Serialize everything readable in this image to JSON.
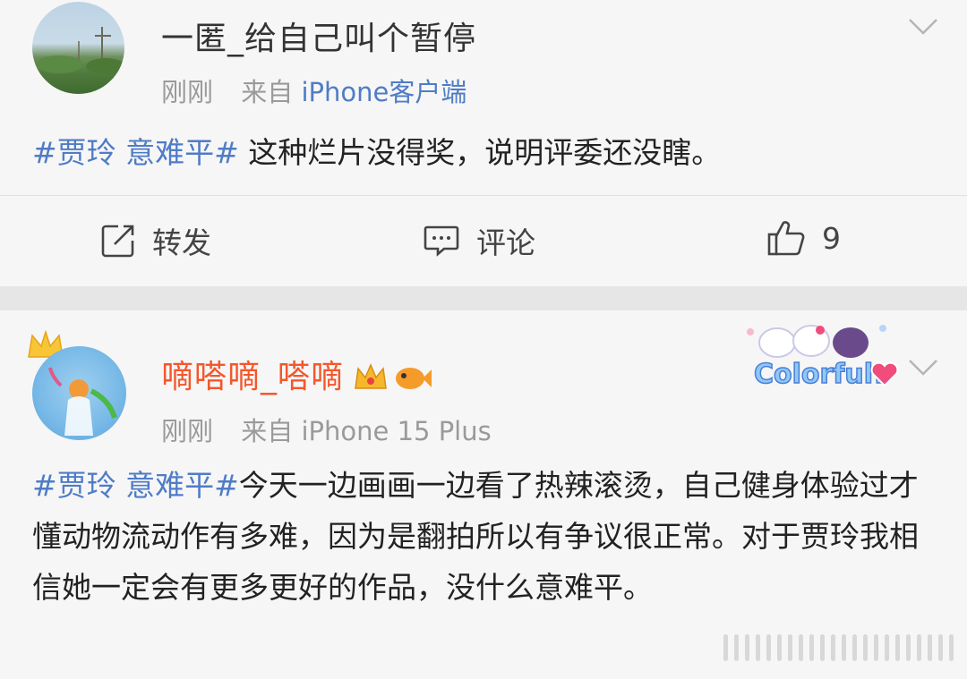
{
  "post1": {
    "username": "一匿_给自己叫个暂停",
    "time": "刚刚",
    "source_prefix": "来自",
    "source": "iPhone客户端",
    "hashtag": "#贾玲 意难平#",
    "text": " 这种烂片没得奖，说明评委还没瞎。",
    "actions": {
      "repost_label": "转发",
      "comment_label": "评论",
      "like_count": "9"
    }
  },
  "post2": {
    "username": "嘀嗒嘀_嗒嘀",
    "time": "刚刚",
    "source_prefix": "来自",
    "source": "iPhone 15 Plus",
    "hashtag": "#贾玲 意难平#",
    "text": "今天一边画画一边看了热辣滚烫，自己健身体验过才懂动物流动作有多难，因为是翻拍所以有争议很正常。对于贾玲我相信她一定会有更多更好的作品，没什么意难平。",
    "badge_text": "Colorful!"
  },
  "colors": {
    "link": "#4f7cc6",
    "vip_name": "#f4572b",
    "meta": "#9a9a9a"
  },
  "icons": [
    "chevron-down-icon",
    "repost-icon",
    "comment-icon",
    "thumbs-up-icon",
    "crown-icon",
    "heart-icon"
  ]
}
